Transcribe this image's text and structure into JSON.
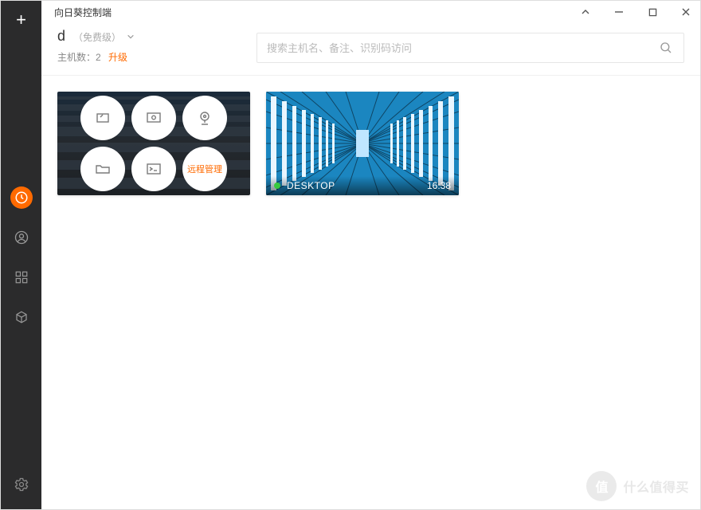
{
  "window": {
    "title": "向日葵控制端"
  },
  "account": {
    "name": "d",
    "tier": "（免费级）",
    "hosts_label": "主机数：",
    "hosts_count": "2",
    "upgrade_label": "升级"
  },
  "search": {
    "placeholder": "搜索主机名、备注、识别码访问"
  },
  "hosts": [
    {
      "type": "actions",
      "actions": [
        {
          "id": "desktop",
          "label": ""
        },
        {
          "id": "view",
          "label": ""
        },
        {
          "id": "camera",
          "label": ""
        },
        {
          "id": "file",
          "label": ""
        },
        {
          "id": "cmd",
          "label": ""
        },
        {
          "id": "remote-mgmt",
          "label": "远程管理"
        }
      ]
    },
    {
      "type": "thumbnail",
      "name": "DESKTOP",
      "time": "16:38",
      "status": "online"
    }
  ],
  "sidebar": {
    "items": [
      {
        "id": "hosts",
        "active": true
      },
      {
        "id": "discover",
        "active": false
      },
      {
        "id": "apps",
        "active": false
      },
      {
        "id": "3d",
        "active": false
      }
    ]
  },
  "watermark": {
    "badge": "值",
    "text": "什么值得买"
  }
}
